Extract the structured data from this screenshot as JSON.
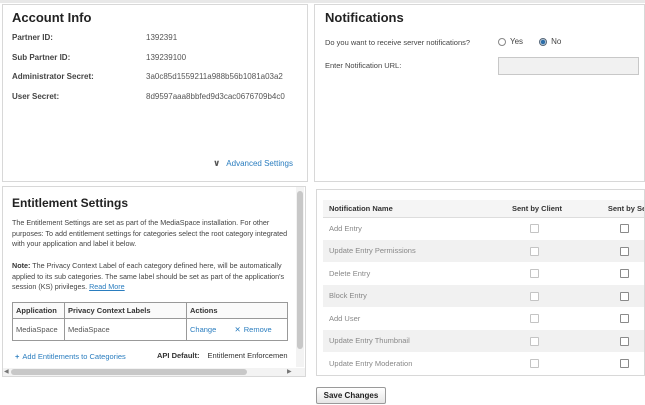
{
  "account": {
    "title": "Account Info",
    "fields": [
      {
        "label": "Partner ID:",
        "value": "1392391"
      },
      {
        "label": "Sub Partner ID:",
        "value": "139239100"
      },
      {
        "label": "Administrator Secret:",
        "value": "3a0c85d1559211a988b56b1081a03a2"
      },
      {
        "label": "User Secret:",
        "value": "8d9597aaa8bbfed9d3cac0676709b4c0"
      }
    ],
    "advanced_link": "Advanced Settings"
  },
  "notifications": {
    "title": "Notifications",
    "question": "Do you want to receive server notifications?",
    "yes_label": "Yes",
    "no_label": "No",
    "selected": "No",
    "url_label": "Enter Notification URL:",
    "url_value": ""
  },
  "entitlement": {
    "title": "Entitlement Settings",
    "intro": "The Entitlement Settings are set as part of the MediaSpace installation. For other purposes: To add entitlement settings for categories select the root category integrated with your application and label it below.",
    "note_label": "Note:",
    "note_text": " The Privacy Context Label of each category defined here, will be automatically applied to its sub categories. The same label should be set as part of the application's session (KS) privileges.",
    "read_more": "Read More",
    "columns": [
      "Application",
      "Privacy Context Labels",
      "Actions"
    ],
    "rows": [
      {
        "application": "MediaSpace",
        "labels": "MediaSpace",
        "change": "Change",
        "remove": "Remove"
      }
    ],
    "add_link": "Add Entitlements to Categories",
    "api_default_label": "API Default:",
    "api_default_value": "Entitlement Enforcemen"
  },
  "notification_table": {
    "columns": [
      "Notification Name",
      "Sent by Client",
      "Sent by Se"
    ],
    "rows": [
      "Add Entry",
      "Update Entry Permissions",
      "Delete Entry",
      "Block Entry",
      "Add User",
      "Update Entry Thumbnail",
      "Update Entry Moderation"
    ]
  },
  "save_button": "Save Changes",
  "colors": {
    "link": "#2a7dbf",
    "border": "#d8d8d8",
    "alt_row": "#f1f1f1"
  }
}
